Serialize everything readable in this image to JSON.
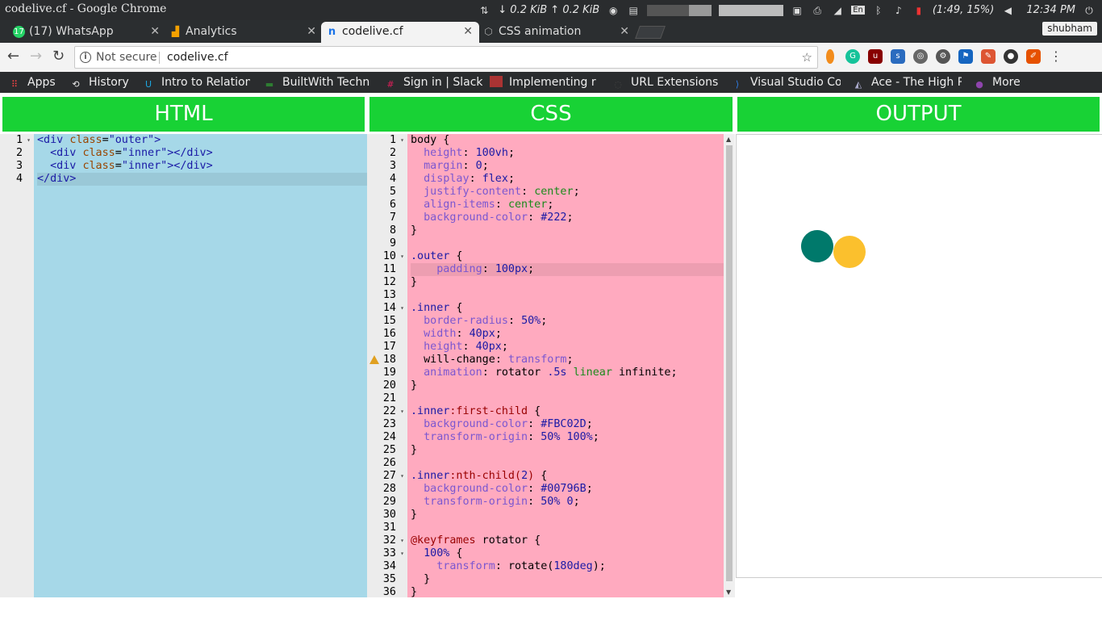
{
  "window": {
    "title": "codelive.cf - Google Chrome"
  },
  "system": {
    "net": "↓ 0.2 KiB ↑ 0.2 KiB",
    "lang": "En",
    "battery": "(1:49, 15%)",
    "time": "12:34 PM"
  },
  "tabs": [
    {
      "label": "(17) WhatsApp",
      "icon": "whatsapp-icon",
      "badge": "17"
    },
    {
      "label": "Analytics",
      "icon": "analytics-icon"
    },
    {
      "label": "codelive.cf",
      "icon": "codelive-icon",
      "active": true
    },
    {
      "label": "CSS animation",
      "icon": "codepen-icon"
    }
  ],
  "profile": {
    "name": "shubham"
  },
  "address": {
    "security": "Not secure",
    "url": "codelive.cf"
  },
  "bookmarks": [
    {
      "label": "Apps",
      "icon": "apps-grid-icon"
    },
    {
      "label": "History",
      "icon": "history-icon"
    },
    {
      "label": "Intro to Relation",
      "icon": "udacity-icon"
    },
    {
      "label": "BuiltWith Techn",
      "icon": "builtwith-icon"
    },
    {
      "label": "Sign in | Slack",
      "icon": "slack-icon"
    },
    {
      "label": "Implementing r",
      "icon": "bookmark-image-icon"
    },
    {
      "label": "URL Extensions",
      "icon": "globe-icon"
    },
    {
      "label": "Visual Studio Co",
      "icon": "vscode-icon"
    },
    {
      "label": "Ace - The High P",
      "icon": "ace-icon"
    },
    {
      "label": "More",
      "icon": "more-icon"
    }
  ],
  "panels": {
    "html": "HTML",
    "css": "CSS",
    "output": "OUTPUT"
  },
  "html_code": [
    [
      {
        "t": "<div ",
        "c": "t-tag"
      },
      {
        "t": "class",
        "c": "t-attr"
      },
      {
        "t": "=",
        "c": "t-plain"
      },
      {
        "t": "\"outer\"",
        "c": "t-str"
      },
      {
        "t": ">",
        "c": "t-tag"
      }
    ],
    [
      {
        "t": "  <div ",
        "c": "t-tag"
      },
      {
        "t": "class",
        "c": "t-attr"
      },
      {
        "t": "=",
        "c": "t-plain"
      },
      {
        "t": "\"inner\"",
        "c": "t-str"
      },
      {
        "t": "></div>",
        "c": "t-tag"
      }
    ],
    [
      {
        "t": "  <div ",
        "c": "t-tag"
      },
      {
        "t": "class",
        "c": "t-attr"
      },
      {
        "t": "=",
        "c": "t-plain"
      },
      {
        "t": "\"inner\"",
        "c": "t-str"
      },
      {
        "t": "></div>",
        "c": "t-tag"
      }
    ],
    [
      {
        "t": "</div>",
        "c": "t-tag"
      }
    ]
  ],
  "css_code": [
    [
      {
        "t": "body {",
        "c": "t-plain"
      }
    ],
    [
      {
        "t": "  height",
        "c": "t-prop"
      },
      {
        "t": ": ",
        "c": "t-plain"
      },
      {
        "t": "100vh",
        "c": "t-num"
      },
      {
        "t": ";",
        "c": "t-plain"
      }
    ],
    [
      {
        "t": "  margin",
        "c": "t-prop"
      },
      {
        "t": ": ",
        "c": "t-plain"
      },
      {
        "t": "0",
        "c": "t-num"
      },
      {
        "t": ";",
        "c": "t-plain"
      }
    ],
    [
      {
        "t": "  display",
        "c": "t-prop"
      },
      {
        "t": ": ",
        "c": "t-plain"
      },
      {
        "t": "flex",
        "c": "t-kw"
      },
      {
        "t": ";",
        "c": "t-plain"
      }
    ],
    [
      {
        "t": "  justify-content",
        "c": "t-prop"
      },
      {
        "t": ": ",
        "c": "t-plain"
      },
      {
        "t": "center",
        "c": "t-val"
      },
      {
        "t": ";",
        "c": "t-plain"
      }
    ],
    [
      {
        "t": "  align-items",
        "c": "t-prop"
      },
      {
        "t": ": ",
        "c": "t-plain"
      },
      {
        "t": "center",
        "c": "t-val"
      },
      {
        "t": ";",
        "c": "t-plain"
      }
    ],
    [
      {
        "t": "  background-color",
        "c": "t-prop"
      },
      {
        "t": ": ",
        "c": "t-plain"
      },
      {
        "t": "#222",
        "c": "t-num"
      },
      {
        "t": ";",
        "c": "t-plain"
      }
    ],
    [
      {
        "t": "}",
        "c": "t-plain"
      }
    ],
    [],
    [
      {
        "t": ".outer",
        "c": "t-sel"
      },
      {
        "t": " {",
        "c": "t-plain"
      }
    ],
    [
      {
        "t": "    padding",
        "c": "t-prop"
      },
      {
        "t": ": ",
        "c": "t-plain"
      },
      {
        "t": "100px",
        "c": "t-num"
      },
      {
        "t": ";",
        "c": "t-plain"
      }
    ],
    [
      {
        "t": "}",
        "c": "t-plain"
      }
    ],
    [],
    [
      {
        "t": ".inner",
        "c": "t-sel"
      },
      {
        "t": " {",
        "c": "t-plain"
      }
    ],
    [
      {
        "t": "  border-radius",
        "c": "t-prop"
      },
      {
        "t": ": ",
        "c": "t-plain"
      },
      {
        "t": "50%",
        "c": "t-num"
      },
      {
        "t": ";",
        "c": "t-plain"
      }
    ],
    [
      {
        "t": "  width",
        "c": "t-prop"
      },
      {
        "t": ": ",
        "c": "t-plain"
      },
      {
        "t": "40px",
        "c": "t-num"
      },
      {
        "t": ";",
        "c": "t-plain"
      }
    ],
    [
      {
        "t": "  height",
        "c": "t-prop"
      },
      {
        "t": ": ",
        "c": "t-plain"
      },
      {
        "t": "40px",
        "c": "t-num"
      },
      {
        "t": ";",
        "c": "t-plain"
      }
    ],
    [
      {
        "t": "  will-change",
        "c": "t-plain"
      },
      {
        "t": ": ",
        "c": "t-plain"
      },
      {
        "t": "transform",
        "c": "t-prop"
      },
      {
        "t": ";",
        "c": "t-plain"
      }
    ],
    [
      {
        "t": "  animation",
        "c": "t-prop"
      },
      {
        "t": ": ",
        "c": "t-plain"
      },
      {
        "t": "rotator ",
        "c": "t-plain"
      },
      {
        "t": ".5s ",
        "c": "t-num"
      },
      {
        "t": "linear ",
        "c": "t-val"
      },
      {
        "t": "infinite",
        "c": "t-plain"
      },
      {
        "t": ";",
        "c": "t-plain"
      }
    ],
    [
      {
        "t": "}",
        "c": "t-plain"
      }
    ],
    [],
    [
      {
        "t": ".inner",
        "c": "t-sel"
      },
      {
        "t": ":first-child",
        "c": "t-at"
      },
      {
        "t": " {",
        "c": "t-plain"
      }
    ],
    [
      {
        "t": "  background-color",
        "c": "t-prop"
      },
      {
        "t": ": ",
        "c": "t-plain"
      },
      {
        "t": "#FBC02D",
        "c": "t-num"
      },
      {
        "t": ";",
        "c": "t-plain"
      }
    ],
    [
      {
        "t": "  transform-origin",
        "c": "t-prop"
      },
      {
        "t": ": ",
        "c": "t-plain"
      },
      {
        "t": "50% 100%",
        "c": "t-num"
      },
      {
        "t": ";",
        "c": "t-plain"
      }
    ],
    [
      {
        "t": "}",
        "c": "t-plain"
      }
    ],
    [],
    [
      {
        "t": ".inner",
        "c": "t-sel"
      },
      {
        "t": ":nth-child(",
        "c": "t-at"
      },
      {
        "t": "2",
        "c": "t-num"
      },
      {
        "t": ")",
        "c": "t-at"
      },
      {
        "t": " {",
        "c": "t-plain"
      }
    ],
    [
      {
        "t": "  background-color",
        "c": "t-prop"
      },
      {
        "t": ": ",
        "c": "t-plain"
      },
      {
        "t": "#00796B",
        "c": "t-num"
      },
      {
        "t": ";",
        "c": "t-plain"
      }
    ],
    [
      {
        "t": "  transform-origin",
        "c": "t-prop"
      },
      {
        "t": ": ",
        "c": "t-plain"
      },
      {
        "t": "50% 0",
        "c": "t-num"
      },
      {
        "t": ";",
        "c": "t-plain"
      }
    ],
    [
      {
        "t": "}",
        "c": "t-plain"
      }
    ],
    [],
    [
      {
        "t": "@keyframes",
        "c": "t-at"
      },
      {
        "t": " rotator {",
        "c": "t-plain"
      }
    ],
    [
      {
        "t": "  100%",
        "c": "t-num"
      },
      {
        "t": " {",
        "c": "t-plain"
      }
    ],
    [
      {
        "t": "    transform",
        "c": "t-prop"
      },
      {
        "t": ": ",
        "c": "t-plain"
      },
      {
        "t": "rotate(",
        "c": "t-plain"
      },
      {
        "t": "180deg",
        "c": "t-num"
      },
      {
        "t": ");",
        "c": "t-plain"
      }
    ],
    [
      {
        "t": "  }",
        "c": "t-plain"
      }
    ],
    [
      {
        "t": "}",
        "c": "t-plain"
      }
    ]
  ],
  "html_folds": [
    1
  ],
  "css_folds": [
    1,
    10,
    14,
    22,
    27,
    32,
    33
  ],
  "css_warning_line": 18,
  "colors": {
    "header": "#18d235",
    "html_bg": "#a6d8e8",
    "css_bg": "#ffaabf",
    "teal": "#00796B",
    "yellow": "#FBC02D"
  }
}
